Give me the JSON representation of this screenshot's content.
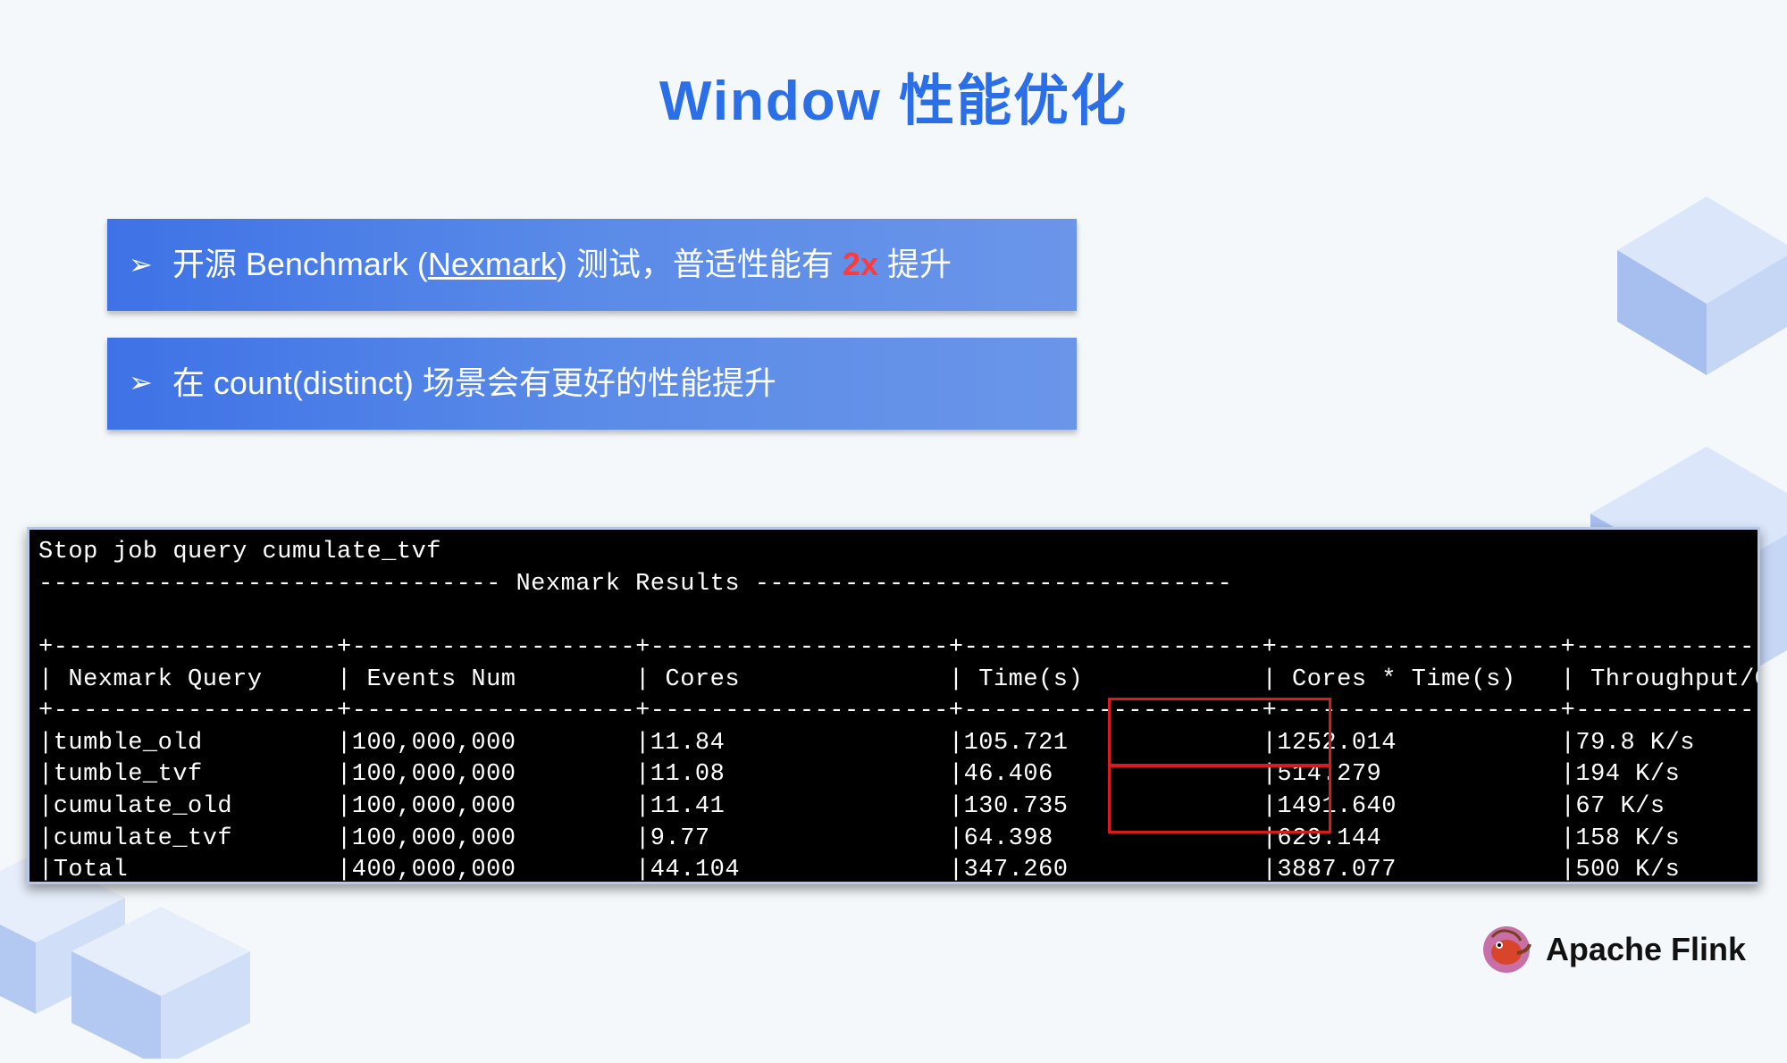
{
  "title": "Window 性能优化",
  "bullets": [
    {
      "pre": "开源 Benchmark (",
      "link": "Nexmark",
      "mid": ") 测试，普适性能有 ",
      "accent": "2x",
      "post": " 提升"
    },
    {
      "pre": "在 count(distinct) 场景会有更好的性能提升",
      "link": "",
      "mid": "",
      "accent": "",
      "post": ""
    }
  ],
  "terminal": {
    "stop_line": "Stop job query cumulate_tvf",
    "result_header": "------------------------------- Nexmark Results --------------------------------",
    "columns": [
      "Nexmark Query",
      "Events Num",
      "Cores",
      "Time(s)",
      "Cores * Time(s)",
      "Throughput/Cores"
    ],
    "rows": [
      {
        "query": "tumble_old",
        "events": "100,000,000",
        "cores": "11.84",
        "time": "105.721",
        "ct": "1252.014",
        "tp": "79.8 K/s"
      },
      {
        "query": "tumble_tvf",
        "events": "100,000,000",
        "cores": "11.08",
        "time": "46.406",
        "ct": "514.279",
        "tp": "194 K/s"
      },
      {
        "query": "cumulate_old",
        "events": "100,000,000",
        "cores": "11.41",
        "time": "130.735",
        "ct": "1491.640",
        "tp": "67 K/s"
      },
      {
        "query": "cumulate_tvf",
        "events": "100,000,000",
        "cores": "9.77",
        "time": "64.398",
        "ct": "629.144",
        "tp": "158 K/s"
      },
      {
        "query": "Total",
        "events": "400,000,000",
        "cores": "44.104",
        "time": "347.260",
        "ct": "3887.077",
        "tp": "500 K/s"
      }
    ]
  },
  "brand": "Apache Flink",
  "chart_data": {
    "type": "table",
    "title": "Nexmark Results",
    "columns": [
      "Nexmark Query",
      "Events Num",
      "Cores",
      "Time(s)",
      "Cores * Time(s)",
      "Throughput/Cores"
    ],
    "rows": [
      [
        "tumble_old",
        100000000,
        11.84,
        105.721,
        1252.014,
        "79.8 K/s"
      ],
      [
        "tumble_tvf",
        100000000,
        11.08,
        46.406,
        514.279,
        "194 K/s"
      ],
      [
        "cumulate_old",
        100000000,
        11.41,
        130.735,
        1491.64,
        "67 K/s"
      ],
      [
        "cumulate_tvf",
        100000000,
        9.77,
        64.398,
        629.144,
        "158 K/s"
      ],
      [
        "Total",
        400000000,
        44.104,
        347.26,
        3887.077,
        "500 K/s"
      ]
    ],
    "highlighted_column": "Cores * Time(s)",
    "highlighted_pairs": [
      [
        "1252.014",
        "514.279"
      ],
      [
        "1491.640",
        "629.144"
      ]
    ]
  }
}
